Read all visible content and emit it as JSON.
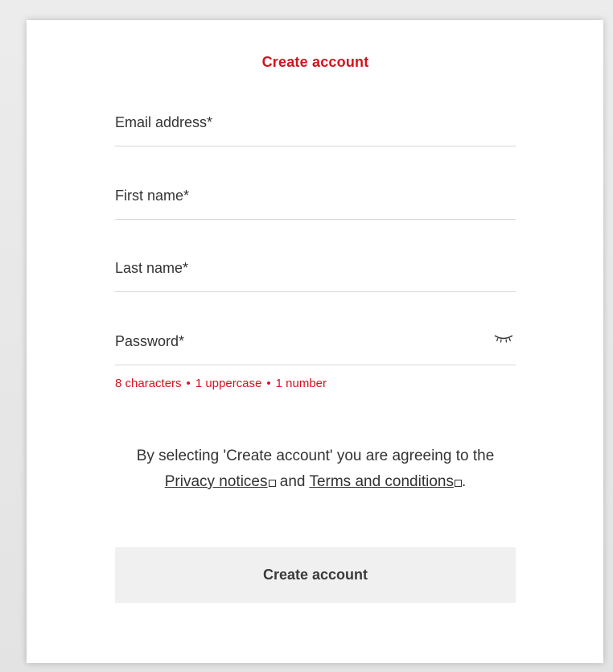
{
  "page": {
    "title": "Create account"
  },
  "form": {
    "fields": [
      {
        "label": "Email address*",
        "value": ""
      },
      {
        "label": "First name*",
        "value": ""
      },
      {
        "label": "Last name*",
        "value": ""
      },
      {
        "label": "Password*",
        "value": ""
      }
    ],
    "password_hint": {
      "items": [
        "8 characters",
        "1 uppercase",
        "1 number"
      ],
      "separator": "•"
    }
  },
  "legal": {
    "text_before": "By selecting 'Create account' you are agreeing to the",
    "privacy_link": "Privacy notices",
    "and_text": "and",
    "terms_link": "Terms and conditions",
    "end": "."
  },
  "actions": {
    "submit_label": "Create account"
  },
  "colors": {
    "accent": "#d6121f",
    "text": "#333333",
    "button_bg": "#f0f0f0"
  },
  "icons": {
    "password_toggle": "eye-closed-icon",
    "external_link": "external-link-icon"
  }
}
